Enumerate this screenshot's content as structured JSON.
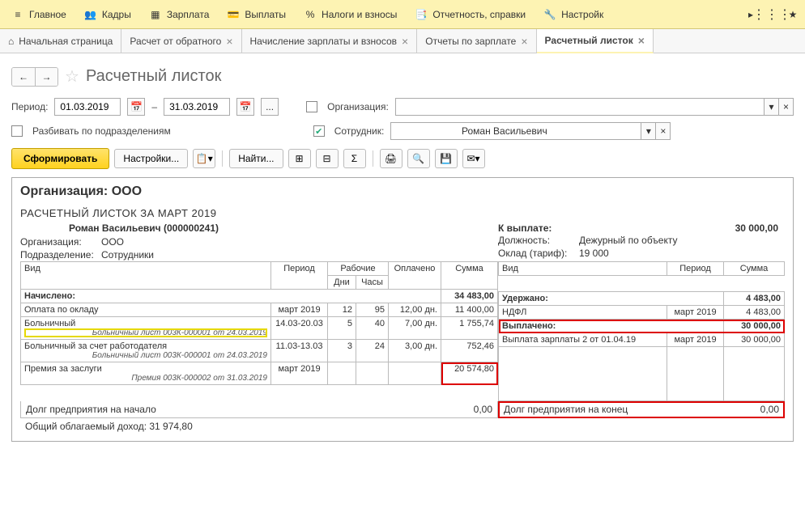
{
  "topmenu": {
    "main": "Главное",
    "kadry": "Кадры",
    "zarplata": "Зарплата",
    "vyplaty": "Выплаты",
    "nalogi": "Налоги и взносы",
    "otchet": "Отчетность, справки",
    "nastroyki": "Настройк"
  },
  "tabs": {
    "home": "Начальная страница",
    "t1": "Расчет от обратного",
    "t2": "Начисление зарплаты и взносов",
    "t3": "Отчеты по зарплате",
    "t4": "Расчетный листок"
  },
  "page": {
    "title": "Расчетный листок"
  },
  "filter": {
    "period_lbl": "Период:",
    "date_from": "01.03.2019",
    "date_to": "31.03.2019",
    "dash": "–",
    "ellipsis": "...",
    "org_lbl": "Организация:",
    "split_lbl": "Разбивать по подразделениям",
    "emp_lbl": "Сотрудник:",
    "emp_val": "Роман Васильевич"
  },
  "toolbar": {
    "submit": "Сформировать",
    "settings": "Настройки...",
    "find": "Найти..."
  },
  "report": {
    "orghdr": "Организация: ООО",
    "title": "РАСЧЕТНЫЙ ЛИСТОК ЗА МАРТ 2019",
    "name": "Роман Васильевич (000000241)",
    "org_k": "Организация:",
    "org_v": "ООО",
    "dep_k": "Подразделение:",
    "dep_v": "Сотрудники",
    "pay_k": "К выплате:",
    "pay_v": "30 000,00",
    "pos_k": "Должность:",
    "pos_v": "Дежурный по объекту",
    "sal_k": "Оклад (тариф):",
    "sal_v": "19 000",
    "th_vid": "Вид",
    "th_period": "Период",
    "th_rab": "Рабочие",
    "th_dni": "Дни",
    "th_chasy": "Часы",
    "th_opl": "Оплачено",
    "th_sum": "Сумма",
    "nach": "Начислено:",
    "nach_sum": "34 483,00",
    "r1_vid": "Оплата по окладу",
    "r1_per": "март 2019",
    "r1_dni": "12",
    "r1_ch": "95",
    "r1_opl": "12,00 дн.",
    "r1_sum": "11 400,00",
    "r2_vid": "Больничный",
    "r2_per": "14.03-20.03",
    "r2_dni": "5",
    "r2_ch": "40",
    "r2_opl": "7,00 дн.",
    "r2_sum": "1 755,74",
    "r2_sub": "Больничный лист 003К-000001 от 24.03.2019",
    "r3_vid": "Больничный за счет работодателя",
    "r3_per": "11.03-13.03",
    "r3_dni": "3",
    "r3_ch": "24",
    "r3_opl": "3,00 дн.",
    "r3_sum": "752,46",
    "r3_sub": "Больничный лист 003К-000001 от 24.03.2019",
    "r4_vid": "Премия за заслуги",
    "r4_per": "март 2019",
    "r4_sum": "20 574,80",
    "r4_sub": "Премия 003К-000002 от 31.03.2019",
    "ud": "Удержано:",
    "ud_sum": "4 483,00",
    "ndfl": "НДФЛ",
    "ndfl_per": "март 2019",
    "ndfl_sum": "4 483,00",
    "vyp": "Выплачено:",
    "vyp_sum": "30 000,00",
    "vy1": "Выплата зарплаты 2 от 01.04.19",
    "vy1_per": "март 2019",
    "vy1_sum": "30 000,00",
    "debt_start": "Долг предприятия на начало",
    "debt_start_v": "0,00",
    "debt_end": "Долг предприятия на конец",
    "debt_end_v": "0,00",
    "taxable": "Общий облагаемый доход: 31 974,80"
  }
}
